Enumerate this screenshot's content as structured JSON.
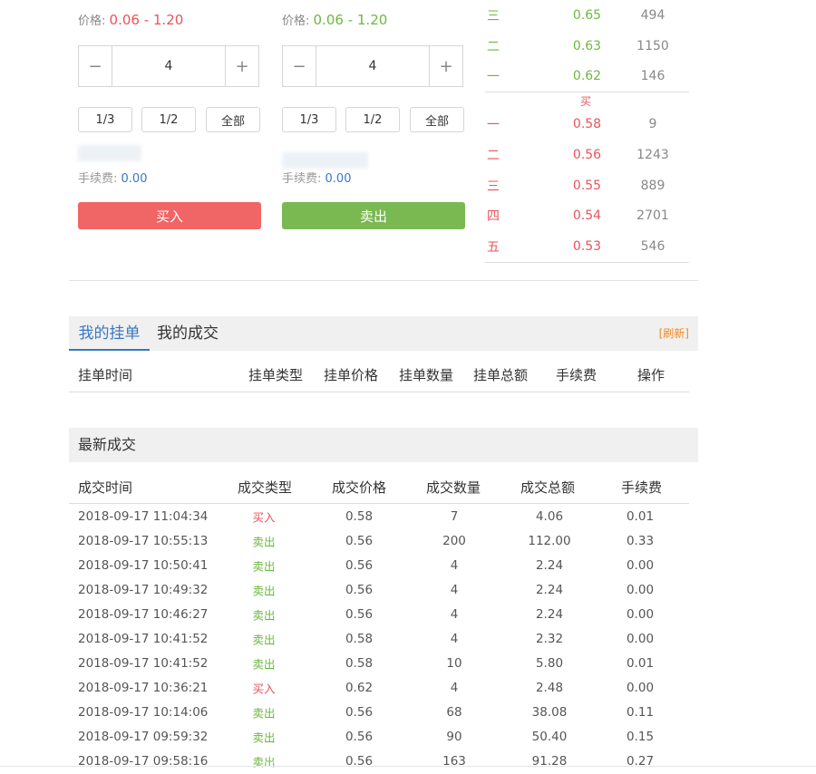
{
  "buy_panel": {
    "price_label": "价格:",
    "price_range": "0.06 - 1.20",
    "quantity": "4",
    "minus": "−",
    "plus": "+",
    "fractions": [
      "1/3",
      "1/2",
      "全部"
    ],
    "fee_label": "手续费:",
    "fee_value": "0.00",
    "button_label": "买入",
    "button_color": "#f06565"
  },
  "sell_panel": {
    "price_label": "价格:",
    "price_range": "0.06 - 1.20",
    "quantity": "4",
    "minus": "−",
    "plus": "+",
    "fractions": [
      "1/3",
      "1/2",
      "全部"
    ],
    "fee_label": "手续费:",
    "fee_value": "0.00",
    "button_label": "卖出",
    "button_color": "#7ab851"
  },
  "order_book": {
    "asks": [
      {
        "level": "三",
        "price": "0.65",
        "qty": "494"
      },
      {
        "level": "二",
        "price": "0.63",
        "qty": "1150"
      },
      {
        "level": "一",
        "price": "0.62",
        "qty": "146"
      }
    ],
    "divider_label": "买",
    "bids": [
      {
        "level": "一",
        "price": "0.58",
        "qty": "9"
      },
      {
        "level": "二",
        "price": "0.56",
        "qty": "1243"
      },
      {
        "level": "三",
        "price": "0.55",
        "qty": "889"
      },
      {
        "level": "四",
        "price": "0.54",
        "qty": "2701"
      },
      {
        "level": "五",
        "price": "0.53",
        "qty": "546"
      }
    ]
  },
  "orders": {
    "tab_active": "我的挂单",
    "tab_other": "我的成交",
    "refresh": "[刷新]",
    "headers": [
      "挂单时间",
      "挂单类型",
      "挂单价格",
      "挂单数量",
      "挂单总额",
      "手续费",
      "操作"
    ]
  },
  "latest": {
    "title": "最新成交",
    "headers": [
      "成交时间",
      "成交类型",
      "成交价格",
      "成交数量",
      "成交总额",
      "手续费"
    ],
    "rows": [
      {
        "time": "2018-09-17 11:04:34",
        "type": "买入",
        "side": "buy",
        "price": "0.58",
        "qty": "7",
        "total": "4.06",
        "fee": "0.01"
      },
      {
        "time": "2018-09-17 10:55:13",
        "type": "卖出",
        "side": "sell",
        "price": "0.56",
        "qty": "200",
        "total": "112.00",
        "fee": "0.33"
      },
      {
        "time": "2018-09-17 10:50:41",
        "type": "卖出",
        "side": "sell",
        "price": "0.56",
        "qty": "4",
        "total": "2.24",
        "fee": "0.00"
      },
      {
        "time": "2018-09-17 10:49:32",
        "type": "卖出",
        "side": "sell",
        "price": "0.56",
        "qty": "4",
        "total": "2.24",
        "fee": "0.00"
      },
      {
        "time": "2018-09-17 10:46:27",
        "type": "卖出",
        "side": "sell",
        "price": "0.56",
        "qty": "4",
        "total": "2.24",
        "fee": "0.00"
      },
      {
        "time": "2018-09-17 10:41:52",
        "type": "卖出",
        "side": "sell",
        "price": "0.58",
        "qty": "4",
        "total": "2.32",
        "fee": "0.00"
      },
      {
        "time": "2018-09-17 10:41:52",
        "type": "卖出",
        "side": "sell",
        "price": "0.58",
        "qty": "10",
        "total": "5.80",
        "fee": "0.01"
      },
      {
        "time": "2018-09-17 10:36:21",
        "type": "买入",
        "side": "buy",
        "price": "0.62",
        "qty": "4",
        "total": "2.48",
        "fee": "0.00"
      },
      {
        "time": "2018-09-17 10:14:06",
        "type": "卖出",
        "side": "sell",
        "price": "0.56",
        "qty": "68",
        "total": "38.08",
        "fee": "0.11"
      },
      {
        "time": "2018-09-17 09:59:32",
        "type": "卖出",
        "side": "sell",
        "price": "0.56",
        "qty": "90",
        "total": "50.40",
        "fee": "0.15"
      },
      {
        "time": "2018-09-17 09:58:16",
        "type": "卖出",
        "side": "sell",
        "price": "0.56",
        "qty": "163",
        "total": "91.28",
        "fee": "0.27"
      }
    ]
  },
  "colors": {
    "buy": "#e8545a",
    "sell": "#6cb83f",
    "accent": "#3a78c2",
    "refresh": "#f08a24"
  }
}
